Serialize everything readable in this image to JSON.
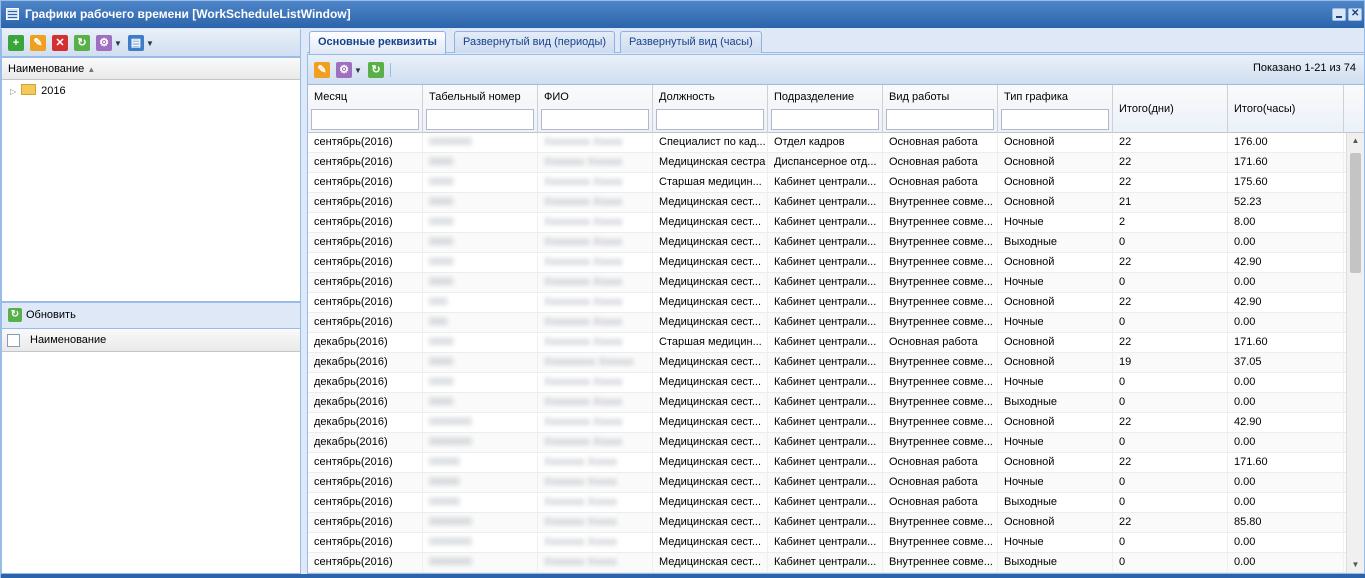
{
  "window": {
    "title": "Графики рабочего времени [WorkScheduleListWindow]"
  },
  "left": {
    "tree_header": "Наименование",
    "tree_items": [
      {
        "label": "2016"
      }
    ],
    "refresh_label": "Обновить",
    "list_header": "Наименование"
  },
  "tabs": [
    {
      "label": "Основные реквизиты"
    },
    {
      "label": "Развернутый вид (периоды)"
    },
    {
      "label": "Развернутый вид (часы)"
    }
  ],
  "grid": {
    "paging": "Показано 1-21 из 74",
    "columns": [
      "Месяц",
      "Табельный номер",
      "ФИО",
      "Должность",
      "Подразделение",
      "Вид работы",
      "Тип графика",
      "Итого(дни)",
      "Итого(часы)"
    ],
    "rows": [
      [
        "сентябрь(2016)",
        "0000000",
        "Хххххххх Ххххх",
        "Специалист по кад...",
        "Отдел кадров",
        "Основная работа",
        "Основной",
        "22",
        "176.00"
      ],
      [
        "сентябрь(2016)",
        "0000",
        "Ххххххх Хххххх",
        "Медицинская сестра",
        "Диспансерное отд...",
        "Основная работа",
        "Основной",
        "22",
        "171.60"
      ],
      [
        "сентябрь(2016)",
        "0000",
        "Хххххххх Ххххх",
        "Старшая медицин...",
        "Кабинет централи...",
        "Основная работа",
        "Основной",
        "22",
        "175.60"
      ],
      [
        "сентябрь(2016)",
        "0000",
        "Хххххххх Ххххх",
        "Медицинская сест...",
        "Кабинет централи...",
        "Внутреннее совме...",
        "Основной",
        "21",
        "52.23"
      ],
      [
        "сентябрь(2016)",
        "0000",
        "Хххххххх Ххххх",
        "Медицинская сест...",
        "Кабинет централи...",
        "Внутреннее совме...",
        "Ночные",
        "2",
        "8.00"
      ],
      [
        "сентябрь(2016)",
        "0000",
        "Хххххххх Ххххх",
        "Медицинская сест...",
        "Кабинет централи...",
        "Внутреннее совме...",
        "Выходные",
        "0",
        "0.00"
      ],
      [
        "сентябрь(2016)",
        "0000",
        "Хххххххх Ххххх",
        "Медицинская сест...",
        "Кабинет централи...",
        "Внутреннее совме...",
        "Основной",
        "22",
        "42.90"
      ],
      [
        "сентябрь(2016)",
        "0000",
        "Хххххххх Ххххх",
        "Медицинская сест...",
        "Кабинет централи...",
        "Внутреннее совме...",
        "Ночные",
        "0",
        "0.00"
      ],
      [
        "сентябрь(2016)",
        "000",
        "Хххххххх Ххххх",
        "Медицинская сест...",
        "Кабинет централи...",
        "Внутреннее совме...",
        "Основной",
        "22",
        "42.90"
      ],
      [
        "сентябрь(2016)",
        "000",
        "Хххххххх Ххххх",
        "Медицинская сест...",
        "Кабинет централи...",
        "Внутреннее совме...",
        "Ночные",
        "0",
        "0.00"
      ],
      [
        "декабрь(2016)",
        "0000",
        "Хххххххх Ххххх",
        "Старшая медицин...",
        "Кабинет централи...",
        "Основная работа",
        "Основной",
        "22",
        "171.60"
      ],
      [
        "декабрь(2016)",
        "0000",
        "Ххххххххх Хххххх",
        "Медицинская сест...",
        "Кабинет централи...",
        "Внутреннее совме...",
        "Основной",
        "19",
        "37.05"
      ],
      [
        "декабрь(2016)",
        "0000",
        "Хххххххх Ххххх",
        "Медицинская сест...",
        "Кабинет централи...",
        "Внутреннее совме...",
        "Ночные",
        "0",
        "0.00"
      ],
      [
        "декабрь(2016)",
        "0000",
        "Хххххххх Ххххх",
        "Медицинская сест...",
        "Кабинет централи...",
        "Внутреннее совме...",
        "Выходные",
        "0",
        "0.00"
      ],
      [
        "декабрь(2016)",
        "0000000",
        "Хххххххх Ххххх",
        "Медицинская сест...",
        "Кабинет централи...",
        "Внутреннее совме...",
        "Основной",
        "22",
        "42.90"
      ],
      [
        "декабрь(2016)",
        "0000000",
        "Хххххххх Ххххх",
        "Медицинская сест...",
        "Кабинет централи...",
        "Внутреннее совме...",
        "Ночные",
        "0",
        "0.00"
      ],
      [
        "сентябрь(2016)",
        "00000",
        "Ххххххх Ххххх",
        "Медицинская сест...",
        "Кабинет централи...",
        "Основная работа",
        "Основной",
        "22",
        "171.60"
      ],
      [
        "сентябрь(2016)",
        "00000",
        "Ххххххх Ххххх",
        "Медицинская сест...",
        "Кабинет централи...",
        "Основная работа",
        "Ночные",
        "0",
        "0.00"
      ],
      [
        "сентябрь(2016)",
        "00000",
        "Ххххххх Ххххх",
        "Медицинская сест...",
        "Кабинет централи...",
        "Основная работа",
        "Выходные",
        "0",
        "0.00"
      ],
      [
        "сентябрь(2016)",
        "0000000",
        "Ххххххх Ххххх",
        "Медицинская сест...",
        "Кабинет централи...",
        "Внутреннее совме...",
        "Основной",
        "22",
        "85.80"
      ],
      [
        "сентябрь(2016)",
        "0000000",
        "Ххххххх Ххххх",
        "Медицинская сест...",
        "Кабинет централи...",
        "Внутреннее совме...",
        "Ночные",
        "0",
        "0.00"
      ],
      [
        "сентябрь(2016)",
        "0000000",
        "Ххххххх Ххххх",
        "Медицинская сест...",
        "Кабинет централи...",
        "Внутреннее совме...",
        "Выходные",
        "0",
        "0.00"
      ]
    ]
  },
  "colors": {
    "titlebar": "#2c64ab",
    "border": "#99bbe8",
    "panel_bg": "#dfe8f6"
  }
}
